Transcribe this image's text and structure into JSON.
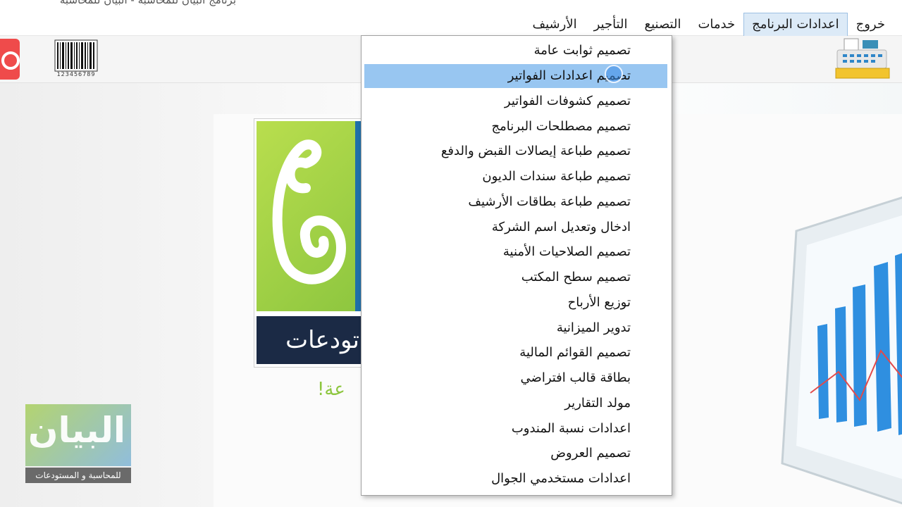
{
  "window": {
    "title": "برنامج البيان للمحاسبة - البيان للمحاسبة"
  },
  "menubar": {
    "items": [
      {
        "label": "الأرشيف",
        "active": false
      },
      {
        "label": "التأجير",
        "active": false
      },
      {
        "label": "التصنيع",
        "active": false
      },
      {
        "label": "خدمات",
        "active": false
      },
      {
        "label": "اعدادات البرنامج",
        "active": true
      },
      {
        "label": "خروج",
        "active": false
      }
    ]
  },
  "toolbar": {
    "icons": [
      "power-icon",
      "barcode-icon",
      "cash-register-icon"
    ],
    "barcode_number": "123456789"
  },
  "dropdown": {
    "items": [
      {
        "label": "تصميم ثوابت عامة"
      },
      {
        "label": "تصميم اعدادات الفواتير",
        "hovered": true
      },
      {
        "label": "تصميم كشوفات الفواتير"
      },
      {
        "label": "تصميم مصطلحات البرنامج"
      },
      {
        "label": "تصميم طباعة إيصالات القبض والدفع"
      },
      {
        "label": "تصميم طباعة سندات الديون"
      },
      {
        "label": "تصميم طباعة بطاقات الأرشيف"
      },
      {
        "label": "ادخال وتعديل اسم الشركة"
      },
      {
        "label": "تصميم الصلاحيات الأمنية"
      },
      {
        "label": "تصميم سطح المكتب"
      },
      {
        "label": "توزيع الأرباح"
      },
      {
        "label": "تدوير الميزانية"
      },
      {
        "label": "تصميم القوائم المالية"
      },
      {
        "label": "بطاقة قالب افتراضي"
      },
      {
        "label": "مولد التقارير"
      },
      {
        "label": "اعدادات نسبة المندوب"
      },
      {
        "label": "تصميم العروض"
      },
      {
        "label": "اعدادات مستخدمي الجوال"
      }
    ]
  },
  "background": {
    "logo_text": "تودعات",
    "tagline": "عة!"
  },
  "watermark": {
    "name": "البيان",
    "subtitle": "للمحاسبة و المستودعات"
  },
  "colors": {
    "menu_active_bg": "#dceaf7",
    "dropdown_hover_bg": "#98c6f1",
    "logo_green": "#8dc63f",
    "logo_dark": "#1b2a45"
  }
}
